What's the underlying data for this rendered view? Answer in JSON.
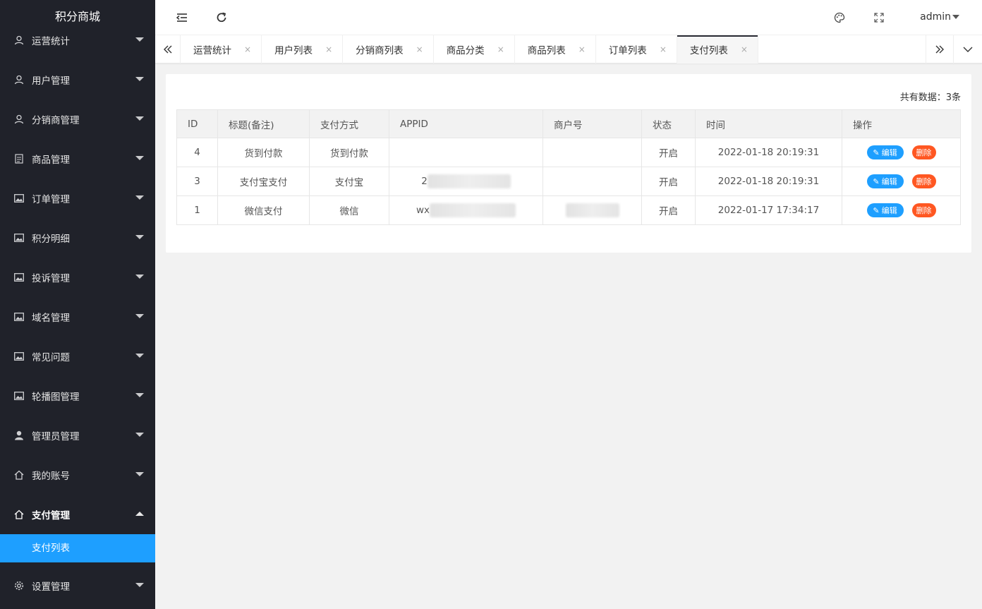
{
  "brand": "积分商城",
  "sidebar": {
    "items": [
      {
        "label": "运营统计",
        "icon": "user-icon"
      },
      {
        "label": "用户管理",
        "icon": "user-icon"
      },
      {
        "label": "分销商管理",
        "icon": "user-icon"
      },
      {
        "label": "商品管理",
        "icon": "file-icon"
      },
      {
        "label": "订单管理",
        "icon": "image-icon"
      },
      {
        "label": "积分明细",
        "icon": "image-icon"
      },
      {
        "label": "投诉管理",
        "icon": "image-icon"
      },
      {
        "label": "域名管理",
        "icon": "image-icon"
      },
      {
        "label": "常见问题",
        "icon": "image-icon"
      },
      {
        "label": "轮播图管理",
        "icon": "image-icon"
      },
      {
        "label": "管理员管理",
        "icon": "person-icon"
      },
      {
        "label": "我的账号",
        "icon": "home-icon"
      },
      {
        "label": "支付管理",
        "icon": "home-icon",
        "open": true
      },
      {
        "label": "设置管理",
        "icon": "gear-icon"
      }
    ],
    "sub_item": "支付列表"
  },
  "header": {
    "user": "admin"
  },
  "tabs": [
    {
      "label": "运营统计"
    },
    {
      "label": "用户列表"
    },
    {
      "label": "分销商列表"
    },
    {
      "label": "商品分类"
    },
    {
      "label": "商品列表"
    },
    {
      "label": "订单列表"
    },
    {
      "label": "支付列表",
      "active": true
    }
  ],
  "tab_close": "×",
  "table": {
    "total_label": "共有数据：",
    "total_value": "3条",
    "columns": [
      "ID",
      "标题(备注)",
      "支付方式",
      "APPID",
      "商户号",
      "状态",
      "时间",
      "操作"
    ],
    "rows": [
      {
        "id": "4",
        "title": "货到付款",
        "method": "货到付款",
        "appid": "",
        "mch": "",
        "status": "开启",
        "time": "2022-01-18 20:19:31"
      },
      {
        "id": "3",
        "title": "支付宝支付",
        "method": "支付宝",
        "appid": "2",
        "mch": "",
        "status": "开启",
        "time": "2022-01-18 20:19:31"
      },
      {
        "id": "1",
        "title": "微信支付",
        "method": "微信",
        "appid": "wx",
        "mch": "",
        "status": "开启",
        "time": "2022-01-17 17:34:17"
      }
    ],
    "edit_label": "编辑",
    "delete_label": "删除"
  },
  "colors": {
    "sidebar_bg": "#20222a",
    "accent": "#1e9fff",
    "danger": "#ff5722"
  }
}
